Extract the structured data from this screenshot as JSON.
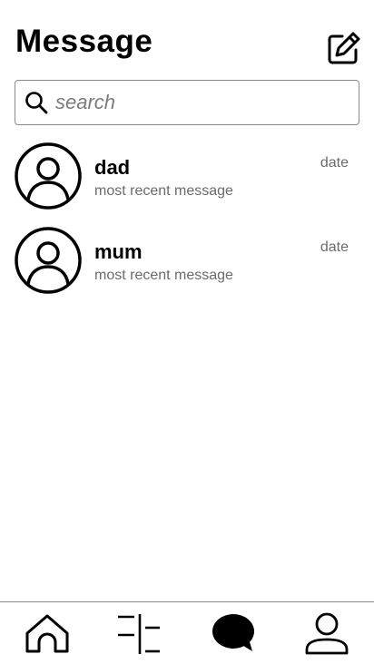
{
  "header": {
    "title": "Message"
  },
  "search": {
    "placeholder": "search",
    "value": ""
  },
  "conversations": [
    {
      "name": "dad",
      "preview": "most recent message",
      "date": "date"
    },
    {
      "name": "mum",
      "preview": "most recent message",
      "date": "date"
    }
  ],
  "tabbar": {
    "tabs": [
      {
        "icon": "home-icon",
        "active": false
      },
      {
        "icon": "filter-icon",
        "active": false
      },
      {
        "icon": "chat-bubble-icon",
        "active": true
      },
      {
        "icon": "profile-icon",
        "active": false
      }
    ]
  }
}
